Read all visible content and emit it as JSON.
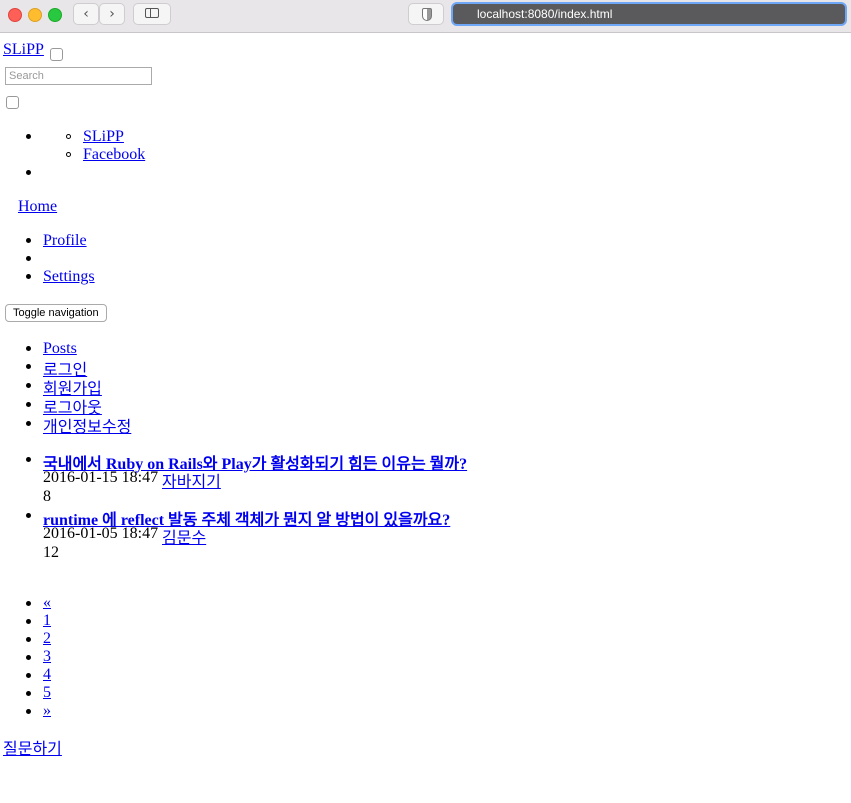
{
  "browser": {
    "url": "localhost:8080/index.html",
    "back_icon": "chevron-left",
    "forward_icon": "chevron-right",
    "sidebar_icon": "sidebar",
    "shield_icon": "shield"
  },
  "brand": "SLiPP",
  "search": {
    "placeholder": "Search"
  },
  "nav_submenu": [
    "SLiPP",
    "Facebook"
  ],
  "home": "Home",
  "profile_menu": [
    " Profile",
    "",
    " Settings"
  ],
  "toggle_label": "Toggle navigation",
  "main_nav": [
    "Posts",
    "로그인",
    "회원가입",
    "로그아웃",
    "개인정보수정"
  ],
  "posts": [
    {
      "title": "국내에서 Ruby on Rails와 Play가 활성화되기 힘든 이유는 뭘까?",
      "date": "2016-01-15 18:47",
      "author": "자바지기",
      "count": "8"
    },
    {
      "title": "runtime 에 reflect 발동 주체 객체가 뭔지 알 방법이 있을까요?",
      "date": "2016-01-05 18:47",
      "author": "김문수",
      "count": "12"
    }
  ],
  "pagination": [
    "«",
    "1",
    "2",
    "3",
    "4",
    "5",
    "»"
  ],
  "ask_button": "질문하기"
}
